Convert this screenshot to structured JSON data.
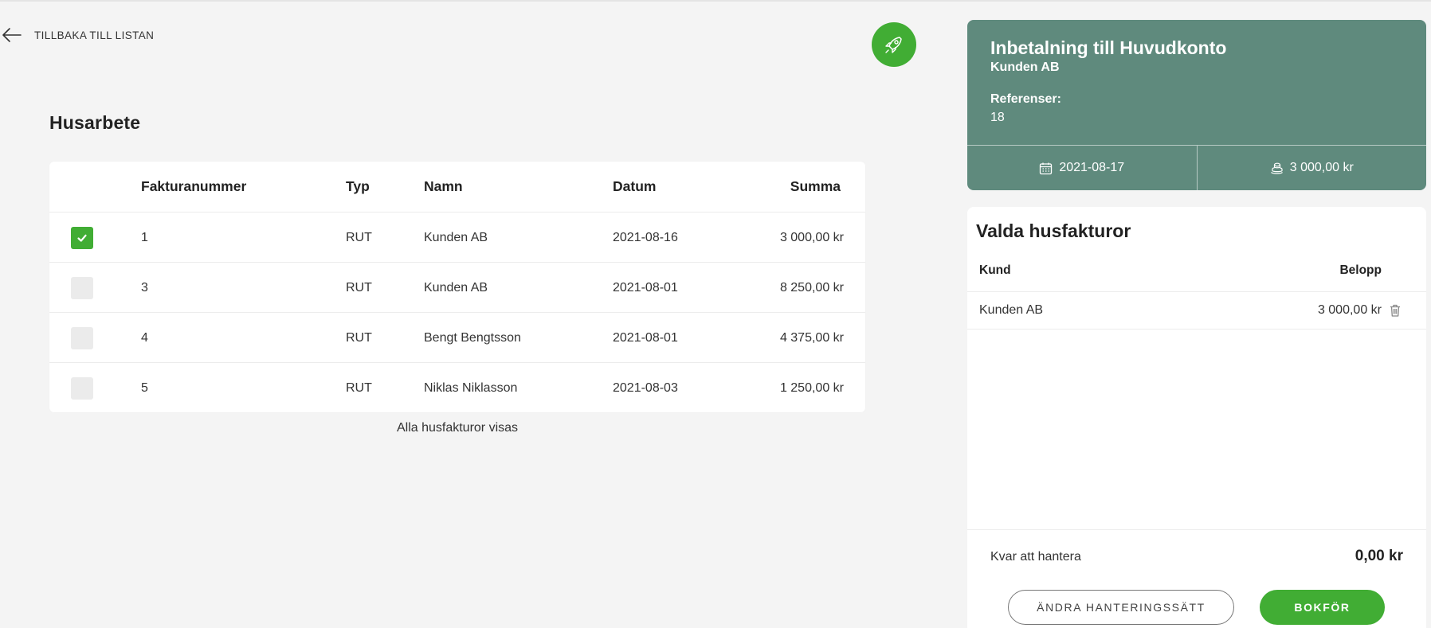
{
  "nav": {
    "back_label": "TILLBAKA TILL LISTAN"
  },
  "section": {
    "title": "Husarbete"
  },
  "table": {
    "headers": {
      "number": "Fakturanummer",
      "type": "Typ",
      "name": "Namn",
      "date": "Datum",
      "sum": "Summa"
    },
    "rows": [
      {
        "number": "1",
        "type": "RUT",
        "name": "Kunden AB",
        "date": "2021-08-16",
        "sum": "3 000,00 kr",
        "checked": true
      },
      {
        "number": "3",
        "type": "RUT",
        "name": "Kunden AB",
        "date": "2021-08-01",
        "sum": "8 250,00 kr",
        "checked": false
      },
      {
        "number": "4",
        "type": "RUT",
        "name": "Bengt Bengtsson",
        "date": "2021-08-01",
        "sum": "4 375,00 kr",
        "checked": false
      },
      {
        "number": "5",
        "type": "RUT",
        "name": "Niklas Niklasson",
        "date": "2021-08-03",
        "sum": "1 250,00 kr",
        "checked": false
      }
    ],
    "footer": "Alla husfakturor visas"
  },
  "payment": {
    "title": "Inbetalning till Huvudkonto",
    "customer": "Kunden AB",
    "references_label": "Referenser:",
    "references_value": "18",
    "date": "2021-08-17",
    "amount": "3 000,00 kr"
  },
  "selected": {
    "title": "Valda husfakturor",
    "headers": {
      "customer": "Kund",
      "amount": "Belopp"
    },
    "rows": [
      {
        "customer": "Kunden AB",
        "amount": "3 000,00 kr"
      }
    ],
    "remaining_label": "Kvar att hantera",
    "remaining_value": "0,00 kr"
  },
  "buttons": {
    "change_method": "ÄNDRA HANTERINGSSÄTT",
    "post": "BOKFÖR"
  },
  "colors": {
    "accent": "#41ad34",
    "card": "#5f8a7d",
    "background": "#f4f4f4"
  }
}
